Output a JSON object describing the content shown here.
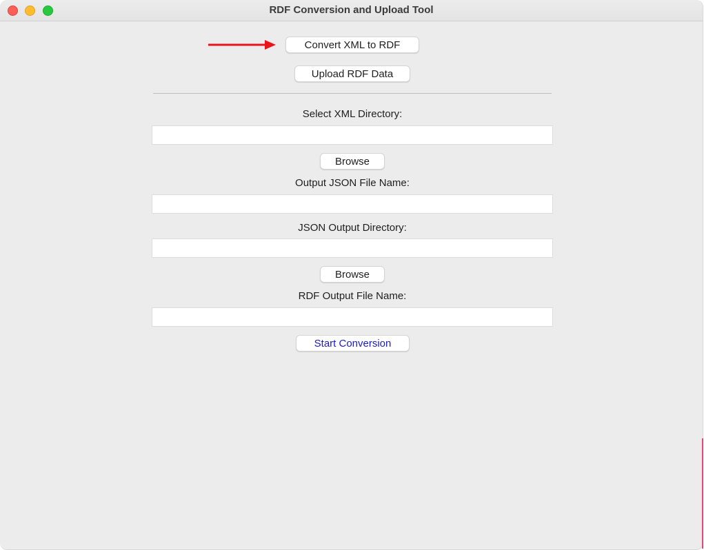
{
  "window": {
    "title": "RDF Conversion and Upload Tool"
  },
  "toolbar": {
    "convert_label": "Convert XML to RDF",
    "upload_label": "Upload RDF Data"
  },
  "form": {
    "xml_dir_label": "Select XML Directory:",
    "xml_dir_value": "",
    "browse_label_1": "Browse",
    "json_file_label": "Output JSON File Name:",
    "json_file_value": "",
    "json_dir_label": "JSON Output Directory:",
    "json_dir_value": "",
    "browse_label_2": "Browse",
    "rdf_file_label": "RDF Output File Name:",
    "rdf_file_value": "",
    "start_label": "Start Conversion"
  },
  "colors": {
    "annotation_arrow": "#e8141a",
    "start_text": "#1a1acc"
  },
  "icons": {
    "annotation": "right-arrow-icon"
  }
}
